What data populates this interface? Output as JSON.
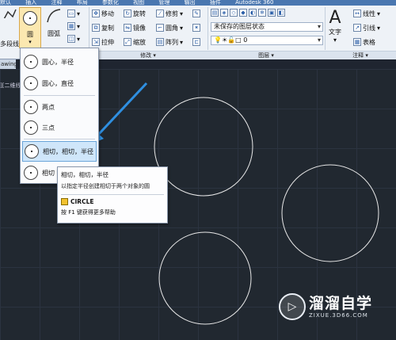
{
  "top_tabs": [
    "默认",
    "插入",
    "注释",
    "布局",
    "参数化",
    "视图",
    "管理",
    "输出",
    "插件",
    "Autodesk 360",
    ""
  ],
  "ribbon": {
    "draw": {
      "polyline_label": "多段线",
      "circle_label": "圆",
      "arc_label": "圆弧"
    },
    "modify": {
      "title": "修改",
      "items": [
        {
          "label": "移动",
          "icon": "move-icon"
        },
        {
          "label": "旋转",
          "icon": "rotate-icon"
        },
        {
          "label": "修剪",
          "icon": "trim-icon"
        },
        {
          "label": "复制",
          "icon": "copy-icon"
        },
        {
          "label": "镜像",
          "icon": "mirror-icon"
        },
        {
          "label": "圆角",
          "icon": "fillet-icon"
        },
        {
          "label": "拉伸",
          "icon": "stretch-icon"
        },
        {
          "label": "缩放",
          "icon": "scale-icon"
        },
        {
          "label": "阵列",
          "icon": "array-icon"
        }
      ]
    },
    "layers": {
      "title": "图层",
      "state_value": "未保存的图层状态",
      "layer_value": "0"
    },
    "annotation": {
      "title": "注释",
      "text_label": "文字",
      "linear_label": "线性",
      "leader_label": "引线",
      "table_label": "表格"
    }
  },
  "file_tab": "awing1",
  "viewport_control": "][二维线",
  "circle_menu": {
    "items": [
      {
        "label": "圆心，半径"
      },
      {
        "label": "圆心，直径"
      },
      {
        "label": "两点"
      },
      {
        "label": "三点"
      },
      {
        "label": "相切，相切，半径"
      },
      {
        "label": "相切"
      }
    ]
  },
  "tooltip": {
    "title": "相切，相切，半径",
    "description": "以指定半径创建相切于两个对象的圆",
    "command": "CIRCLE",
    "help": "按 F1 键获得更多帮助"
  },
  "watermark": {
    "name": "溜溜自学",
    "url": "ZIXUE.3D66.COM"
  },
  "colors": {
    "canvas_bg": "#212830",
    "highlight": "#cfe6fa",
    "arrow": "#2f8fe0"
  }
}
